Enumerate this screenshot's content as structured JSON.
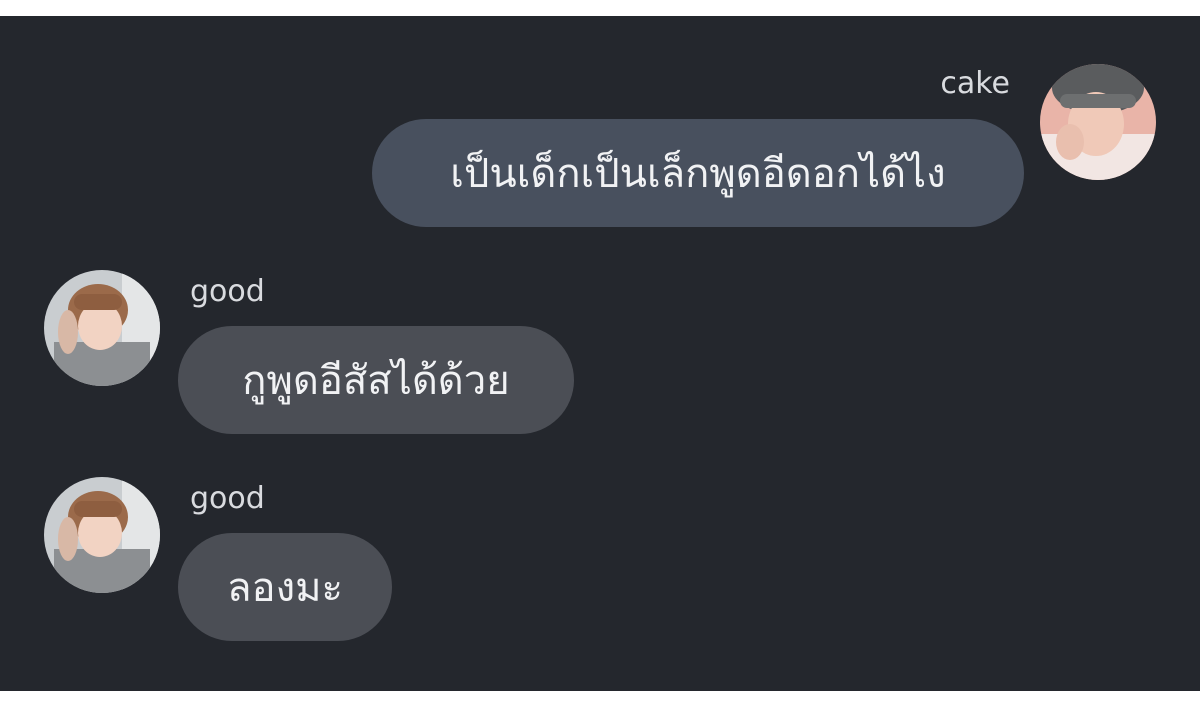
{
  "messages": [
    {
      "sender": "cake",
      "text": "เป็นเด็กเป็นเล็กพูดอีดอกได้ไง",
      "direction": "outgoing",
      "avatar_icon": "user-avatar-icon"
    },
    {
      "sender": "good",
      "text": "กูพูดอีสัสได้ด้วย",
      "direction": "incoming",
      "avatar_icon": "user-avatar-icon"
    },
    {
      "sender": "good",
      "text": "ลองมะ",
      "direction": "incoming",
      "avatar_icon": "user-avatar-icon"
    }
  ],
  "colors": {
    "chat_background": "#24272d",
    "outgoing_bubble": "#48505e",
    "incoming_bubble": "#4b4e55",
    "text": "#f1f2f4",
    "sender_name": "#d9dbdf"
  }
}
